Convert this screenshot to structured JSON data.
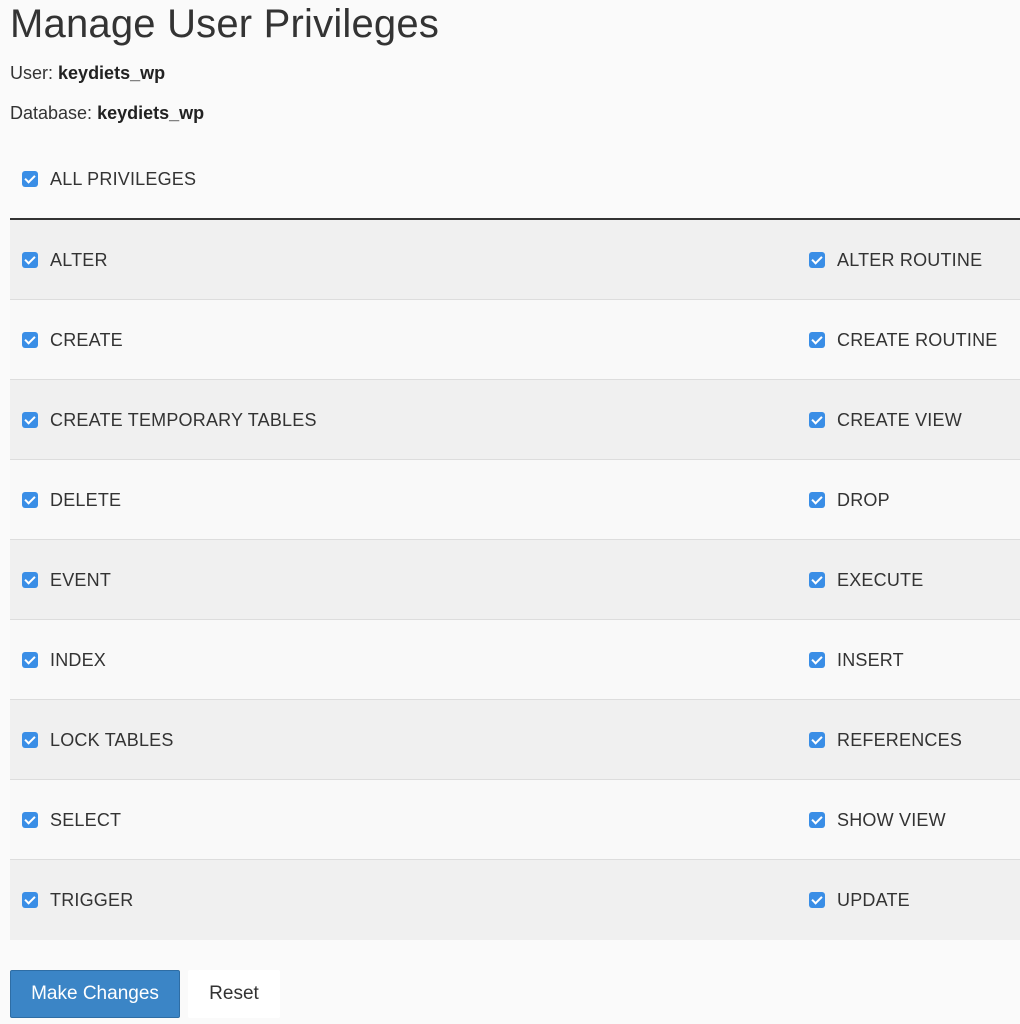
{
  "title": "Manage User Privileges",
  "user": {
    "label": "User:",
    "value": "keydiets_wp"
  },
  "database": {
    "label": "Database:",
    "value": "keydiets_wp"
  },
  "all_privileges": {
    "label": "ALL PRIVILEGES",
    "checked": true
  },
  "rows": [
    {
      "left": {
        "label": "ALTER",
        "checked": true
      },
      "right": {
        "label": "ALTER ROUTINE",
        "checked": true
      }
    },
    {
      "left": {
        "label": "CREATE",
        "checked": true
      },
      "right": {
        "label": "CREATE ROUTINE",
        "checked": true
      }
    },
    {
      "left": {
        "label": "CREATE TEMPORARY TABLES",
        "checked": true
      },
      "right": {
        "label": "CREATE VIEW",
        "checked": true
      }
    },
    {
      "left": {
        "label": "DELETE",
        "checked": true
      },
      "right": {
        "label": "DROP",
        "checked": true
      }
    },
    {
      "left": {
        "label": "EVENT",
        "checked": true
      },
      "right": {
        "label": "EXECUTE",
        "checked": true
      }
    },
    {
      "left": {
        "label": "INDEX",
        "checked": true
      },
      "right": {
        "label": "INSERT",
        "checked": true
      }
    },
    {
      "left": {
        "label": "LOCK TABLES",
        "checked": true
      },
      "right": {
        "label": "REFERENCES",
        "checked": true
      }
    },
    {
      "left": {
        "label": "SELECT",
        "checked": true
      },
      "right": {
        "label": "SHOW VIEW",
        "checked": true
      }
    },
    {
      "left": {
        "label": "TRIGGER",
        "checked": true
      },
      "right": {
        "label": "UPDATE",
        "checked": true
      }
    }
  ],
  "buttons": {
    "make_changes": "Make Changes",
    "reset": "Reset"
  },
  "colors": {
    "checkbox": "#3a8ee6",
    "primary_button": "#3b85c6"
  }
}
